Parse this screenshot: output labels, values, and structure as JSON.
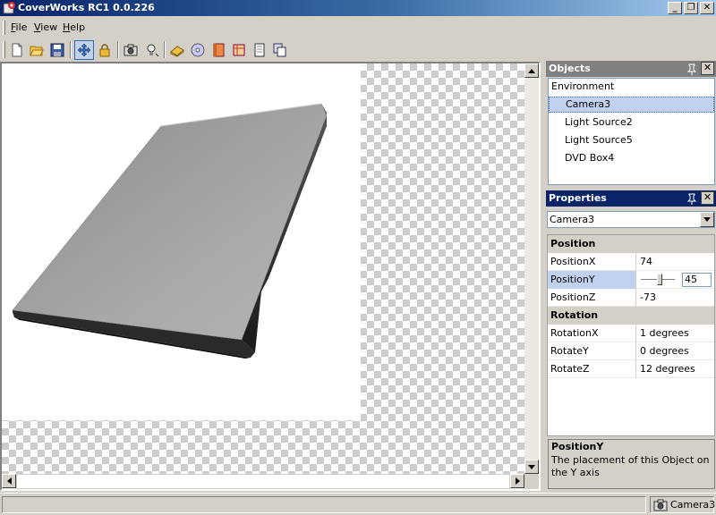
{
  "window": {
    "title": "CoverWorks RC1 0.0.226",
    "icon": "coverworks-app-icon",
    "minimize_label": "_",
    "restore_label": "❐",
    "close_label": "✕"
  },
  "menu": {
    "items": [
      {
        "label": "File"
      },
      {
        "label": "View"
      },
      {
        "label": "Help"
      }
    ]
  },
  "toolbar": {
    "buttons": [
      "new-file-icon",
      "open-folder-icon",
      "save-icon",
      "move-icon",
      "lock-icon",
      "camera-icon",
      "light-icon",
      "box-icon",
      "disc-icon",
      "case-icon",
      "package-icon",
      "book-icon",
      "copy-icon"
    ],
    "pressed": "move-icon"
  },
  "objects_panel": {
    "title": "Objects",
    "items": [
      {
        "label": "Environment",
        "level": 0
      },
      {
        "label": "Camera3",
        "level": 1,
        "selected": true
      },
      {
        "label": "Light Source2",
        "level": 1
      },
      {
        "label": "Light Source5",
        "level": 1
      },
      {
        "label": "DVD Box4",
        "level": 1
      }
    ]
  },
  "properties_panel": {
    "title": "Properties",
    "selected_object": "Camera3",
    "categories": [
      {
        "name": "Position",
        "rows": [
          {
            "name": "PositionX",
            "value": "74"
          },
          {
            "name": "PositionY",
            "value": "45",
            "selected": true,
            "editor": "slider"
          },
          {
            "name": "PositionZ",
            "value": "-73"
          }
        ]
      },
      {
        "name": "Rotation",
        "rows": [
          {
            "name": "RotationX",
            "value": "1 degrees"
          },
          {
            "name": "RotateY",
            "value": "0 degrees"
          },
          {
            "name": "RotateZ",
            "value": "12 degrees"
          }
        ]
      }
    ],
    "help": {
      "title": "PositionY",
      "description": "The placement of this Object on the Y axis"
    }
  },
  "statusbar": {
    "left_text": "",
    "camera_label": "Camera3"
  },
  "colors": {
    "title_gradient_start": "#0a246a",
    "title_gradient_end": "#a6caf0",
    "panel_header_inactive": "#808080",
    "panel_header_active": "#0a246a",
    "selection": "#c1d2ee"
  }
}
